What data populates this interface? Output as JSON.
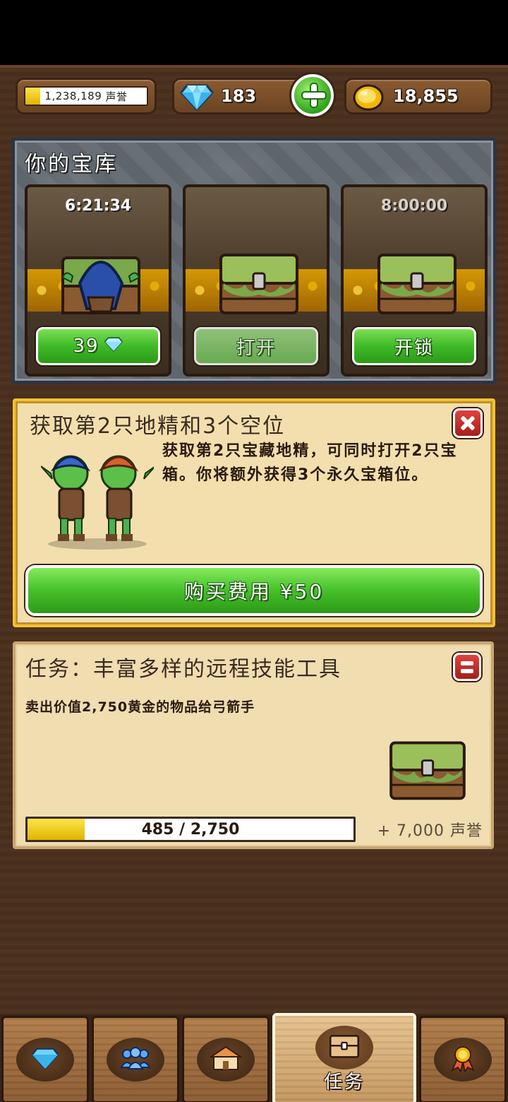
{
  "top_bar": {
    "reputation": {
      "value": "1,238,189",
      "unit": "声誉",
      "progress": 0.12
    },
    "gems": {
      "value": "183"
    },
    "gold": {
      "value": "18,855"
    }
  },
  "vault": {
    "title": "你的宝库",
    "slots": [
      {
        "timer": "6:21:34",
        "button_label": "39",
        "button_icon": "gem-icon",
        "content": "goblin-icon"
      },
      {
        "timer": "",
        "button_label": "打开",
        "content": "chest-icon"
      },
      {
        "timer": "8:00:00",
        "button_label": "开锁",
        "content": "chest-icon"
      }
    ]
  },
  "offer": {
    "title": "获取第2只地精和3个空位",
    "description": "获取第2只宝藏地精，可同时打开2只宝箱。你将额外获得3个永久宝箱位。",
    "buy_label": "购买费用 ¥50"
  },
  "quest": {
    "title": "任务：丰富多样的远程技能工具",
    "description": "卖出价值2,750黄金的物品给弓箭手",
    "progress_text": "485 / 2,750",
    "progress_value": 485,
    "progress_max": 2750,
    "reward": "+ 7,000 声誉"
  },
  "nav": {
    "items": [
      {
        "icon": "gem-icon",
        "label": ""
      },
      {
        "icon": "people-icon",
        "label": ""
      },
      {
        "icon": "house-icon",
        "label": ""
      },
      {
        "icon": "chest-icon",
        "label": "任务",
        "active": true
      },
      {
        "icon": "medal-icon",
        "label": ""
      }
    ]
  },
  "colors": {
    "background": "#4a2f1d",
    "accent_green": "#3fba28",
    "gold_yellow": "#f1c232",
    "close_red": "#c42a24"
  }
}
